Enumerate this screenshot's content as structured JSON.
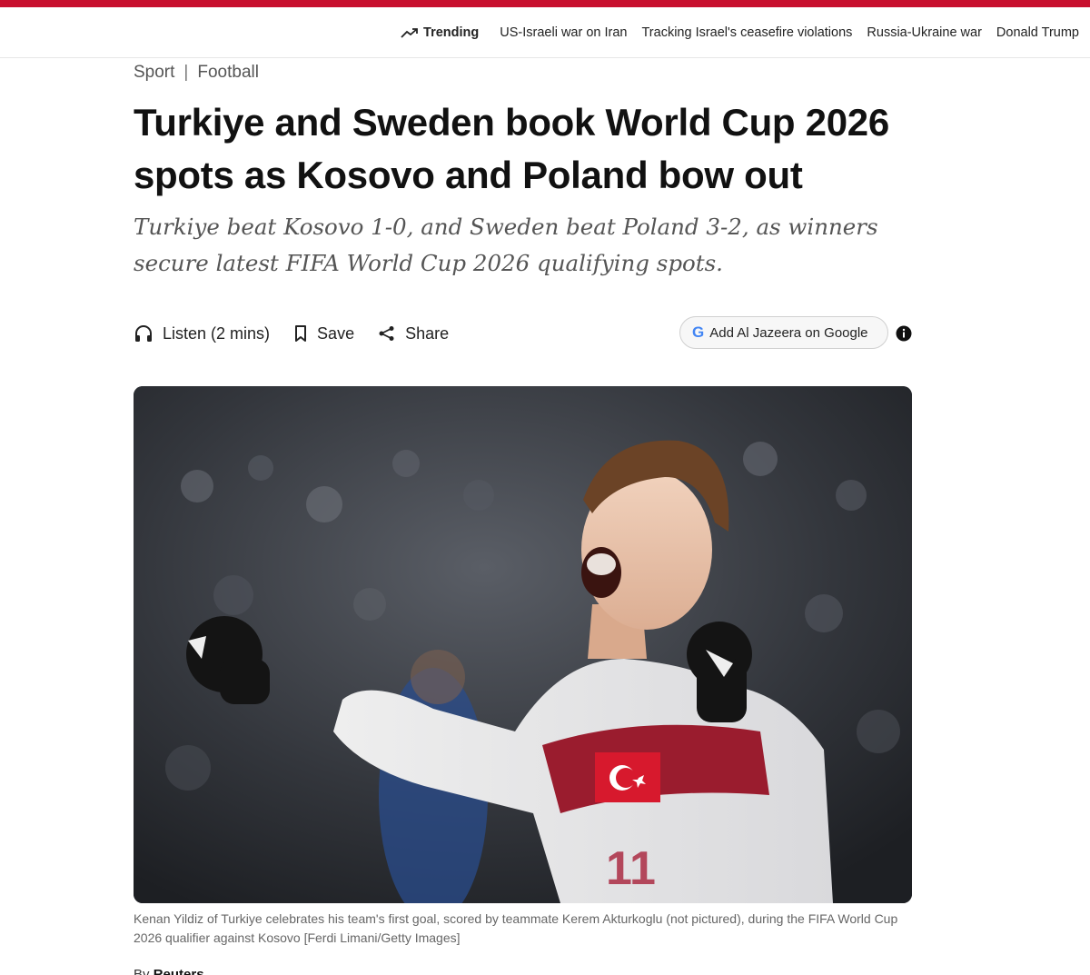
{
  "colors": {
    "accent": "#c8102e",
    "text": "#111111",
    "muted": "#555555"
  },
  "trending": {
    "label": "Trending",
    "icon": "trending-up-icon",
    "links": [
      "US-Israeli war on Iran",
      "Tracking Israel's ceasefire violations",
      "Russia-Ukraine war",
      "Donald Trump"
    ]
  },
  "breadcrumb": {
    "section": "Sport",
    "separator": "|",
    "subsection": "Football"
  },
  "article": {
    "headline": "Turkiye and Sweden book World Cup 2026 spots as Kosovo and Poland bow out",
    "subhead": "Turkiye beat Kosovo 1-0, and Sweden beat Poland 3-2, as winners secure latest FIFA World Cup 2026 qualifying spots.",
    "caption": "Kenan Yildiz of Turkiye celebrates his team's first goal, scored by teammate Kerem Akturkoglu (not pictured), during the FIFA World Cup 2026 qualifier against Kosovo [Ferdi Limani/Getty Images]",
    "byline_prefix": "By",
    "byline_author": "Reuters"
  },
  "actions": {
    "listen_label": "Listen (2 mins)",
    "save_label": "Save",
    "share_label": "Share",
    "google_label": "Add Al Jazeera on Google",
    "google_icon_letter": "G"
  },
  "hero_image": {
    "jersey_number": "11"
  }
}
